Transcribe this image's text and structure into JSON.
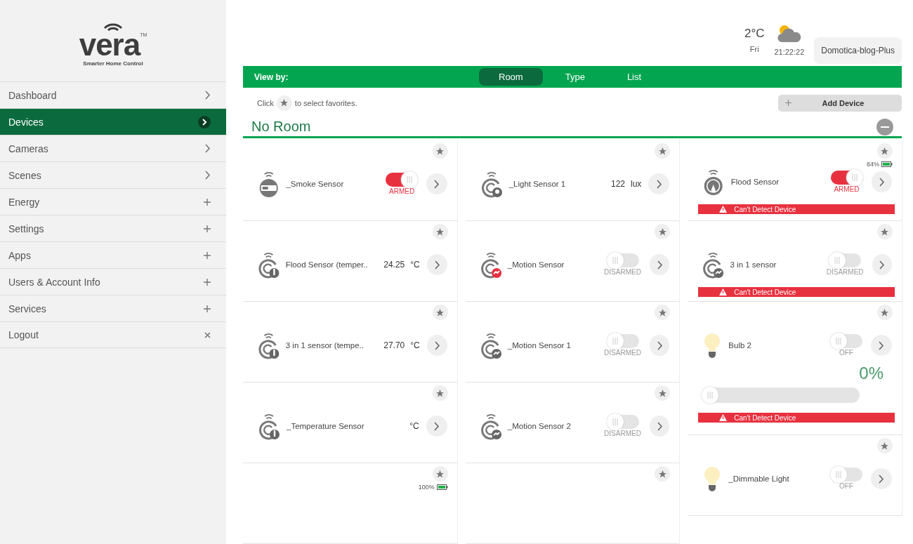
{
  "logo": {
    "name": "vera",
    "tm": "TM",
    "tagline": "Smarter Home Control"
  },
  "sidebar": {
    "items": [
      {
        "label": "Dashboard",
        "kind": "link",
        "selected": false
      },
      {
        "label": "Devices",
        "kind": "link",
        "selected": true
      },
      {
        "label": "Cameras",
        "kind": "link",
        "selected": false
      },
      {
        "label": "Scenes",
        "kind": "link",
        "selected": false
      },
      {
        "label": "Energy",
        "kind": "group",
        "selected": false
      },
      {
        "label": "Settings",
        "kind": "group",
        "selected": false
      },
      {
        "label": "Apps",
        "kind": "group",
        "selected": false
      },
      {
        "label": "Users & Account Info",
        "kind": "group",
        "selected": false
      },
      {
        "label": "Services",
        "kind": "group",
        "selected": false
      },
      {
        "label": "Logout",
        "kind": "action",
        "selected": false
      }
    ]
  },
  "header": {
    "temperature": "2°C",
    "day": "Fri",
    "time": "21:22:22",
    "user": "Domotica-blog-Plus"
  },
  "view_by": {
    "label": "View by:",
    "tabs": [
      {
        "label": "Room",
        "selected": true
      },
      {
        "label": "Type",
        "selected": false
      },
      {
        "label": "List",
        "selected": false
      }
    ]
  },
  "hint": {
    "before": "Click",
    "after": "to select favorites."
  },
  "add_device": "Add Device",
  "room": {
    "name": "No Room",
    "expanded": true
  },
  "columns": [
    {
      "cards": [
        {
          "kind": "smoke",
          "name": "_Smoke Sensor",
          "on": true,
          "status": "ARMED"
        },
        {
          "kind": "temperature",
          "name": "Flood Sensor (temper..",
          "value": "24.25",
          "unit": "°C"
        },
        {
          "kind": "temperature",
          "name": "3 in 1 sensor (tempe..",
          "value": "27.70",
          "unit": "°C"
        },
        {
          "kind": "temperature",
          "name": "_Temperature Sensor",
          "unit": "°C"
        },
        {
          "kind": "partial",
          "battery": "100%"
        }
      ]
    },
    {
      "cards": [
        {
          "kind": "light",
          "name": "_Light Sensor 1",
          "value": "122",
          "unit": "lux"
        },
        {
          "kind": "motion",
          "tripped": true,
          "name": "_Motion Sensor",
          "on": false,
          "status": "DISARMED"
        },
        {
          "kind": "motion",
          "tripped": false,
          "name": "_Motion Sensor 1",
          "on": false,
          "status": "DISARMED"
        },
        {
          "kind": "motion",
          "tripped": false,
          "name": "_Motion Sensor 2",
          "on": false,
          "status": "DISARMED"
        },
        {
          "kind": "partial"
        }
      ]
    },
    {
      "cards": [
        {
          "kind": "flood",
          "name": "Flood Sensor",
          "battery": "84%",
          "on": true,
          "status": "ARMED",
          "alert": "Can't Detect Device"
        },
        {
          "kind": "motion",
          "tripped": false,
          "name": "3 in 1 sensor",
          "on": false,
          "status": "DISARMED",
          "alert": "Can't Detect Device"
        },
        {
          "kind": "dimmer",
          "name": "Bulb 2",
          "on": false,
          "status": "OFF",
          "reading": "0%",
          "level": 0,
          "alert": "Can't Detect Device"
        },
        {
          "kind": "bulb",
          "name": "_Dimmable Light",
          "on": false,
          "status": "OFF"
        }
      ]
    }
  ]
}
